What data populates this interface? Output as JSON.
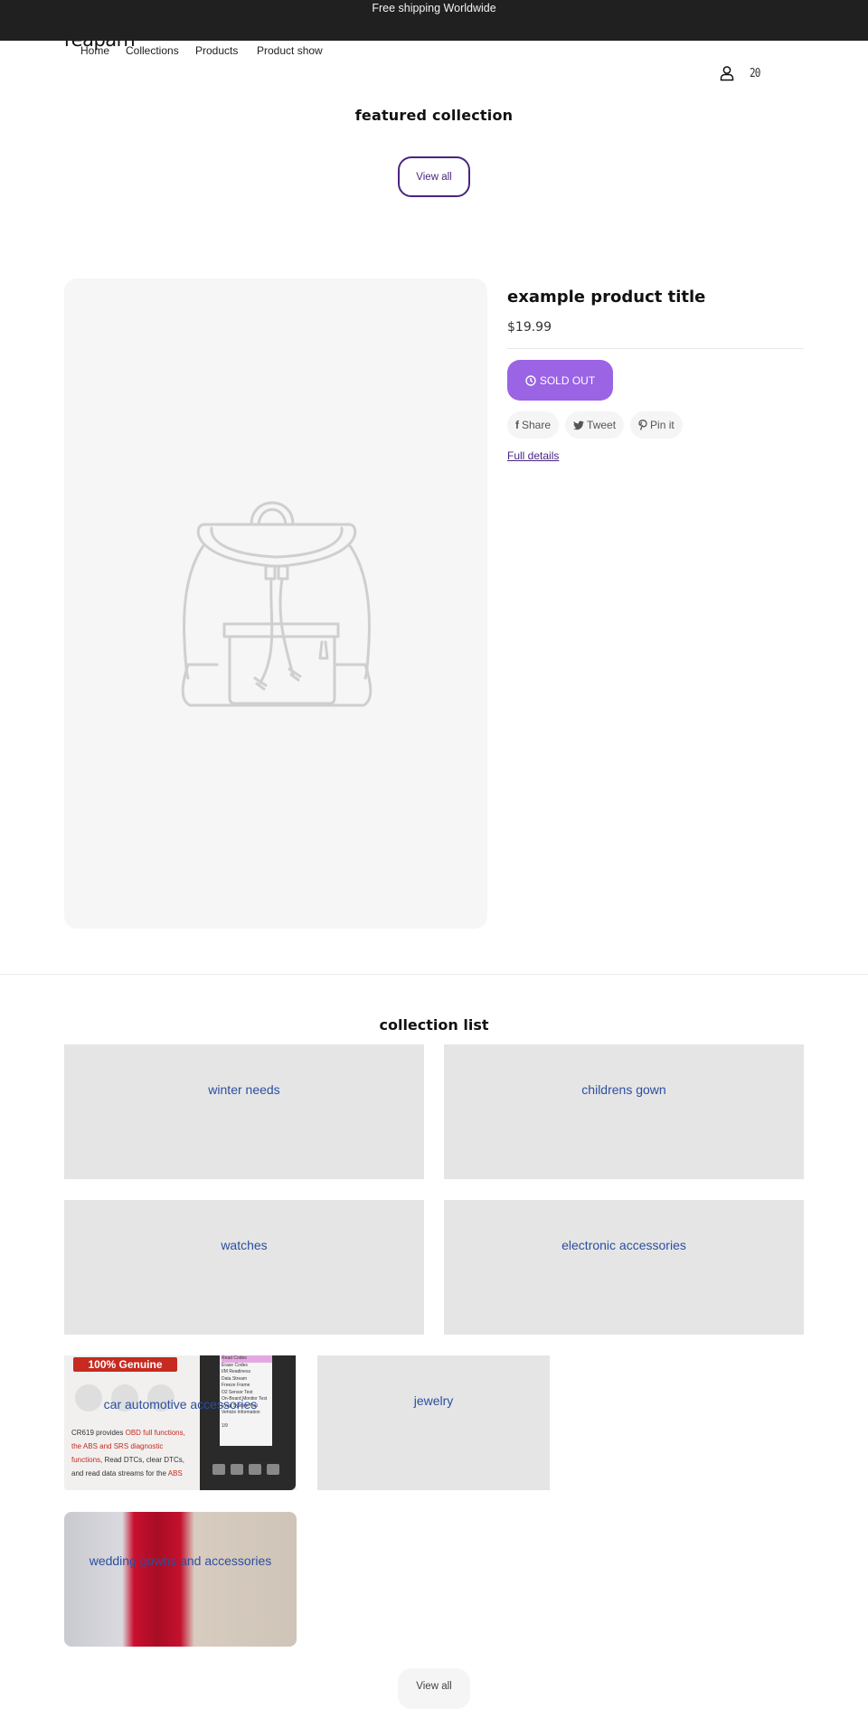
{
  "announcement": {
    "text": "Free shipping Worldwide"
  },
  "header": {
    "logo": "reaparn",
    "nav": [
      {
        "label": "Home"
      },
      {
        "label": "Collections"
      },
      {
        "label": "Products"
      },
      {
        "label": "Product show"
      }
    ],
    "icons": {
      "account": "user-icon",
      "cart": "cart-icon",
      "cart_glyph": "20"
    }
  },
  "featured_collection": {
    "title": "featured collection",
    "view_all_label": "View all",
    "product": {
      "title": "example product title",
      "price": "$19.99",
      "sold_out_label": "SOLD OUT",
      "image_placeholder": "backpack-placeholder",
      "share": [
        {
          "icon": "facebook-icon",
          "glyph": "f",
          "label": "Share"
        },
        {
          "icon": "twitter-icon",
          "glyph": "🐦",
          "label": "Tweet"
        },
        {
          "icon": "pinterest-icon",
          "glyph": "P",
          "label": "Pin it"
        }
      ],
      "full_details_label": "Full details"
    }
  },
  "collection_list": {
    "title": "collection list",
    "items": [
      {
        "label": "winter needs",
        "has_image": false
      },
      {
        "label": "childrens gown",
        "has_image": false
      },
      {
        "label": "watches",
        "has_image": false
      },
      {
        "label": "electronic accessories",
        "has_image": false
      },
      {
        "label": "car automotive accessories",
        "has_image": true
      },
      {
        "label": "jewelry",
        "has_image": false
      },
      {
        "label": "wedding gowns and accessories",
        "has_image": true
      }
    ],
    "obd_image": {
      "badge": "100% Genuine",
      "text_lines": [
        {
          "t": "CR619 provides ",
          "r": "OBD full functions,"
        },
        {
          "t": "",
          "r": "the ABS and SRS diagnostic"
        },
        {
          "t": ", Read DTCs, clear DTCs,",
          "r": "functions",
          "order": "r-first"
        },
        {
          "t": "and read data streams for the ",
          "r": "ABS"
        }
      ],
      "screen_menu": [
        "Read Codes",
        "Erase Codes",
        "I/M Readiness",
        "Data Stream",
        "Freeze Frame",
        "O2 Sensor Test",
        "On-Board Monitor Test",
        "Evap System Test",
        "Vehicle Information",
        "",
        "1/9"
      ]
    },
    "view_all_label": "View all"
  },
  "colors": {
    "announcement_bg": "#202020",
    "accent_purple": "#4a2580",
    "sold_out_bg": "#9a64e4",
    "tile_bg": "#e5e5e5",
    "tile_link": "#2a4fa0"
  }
}
